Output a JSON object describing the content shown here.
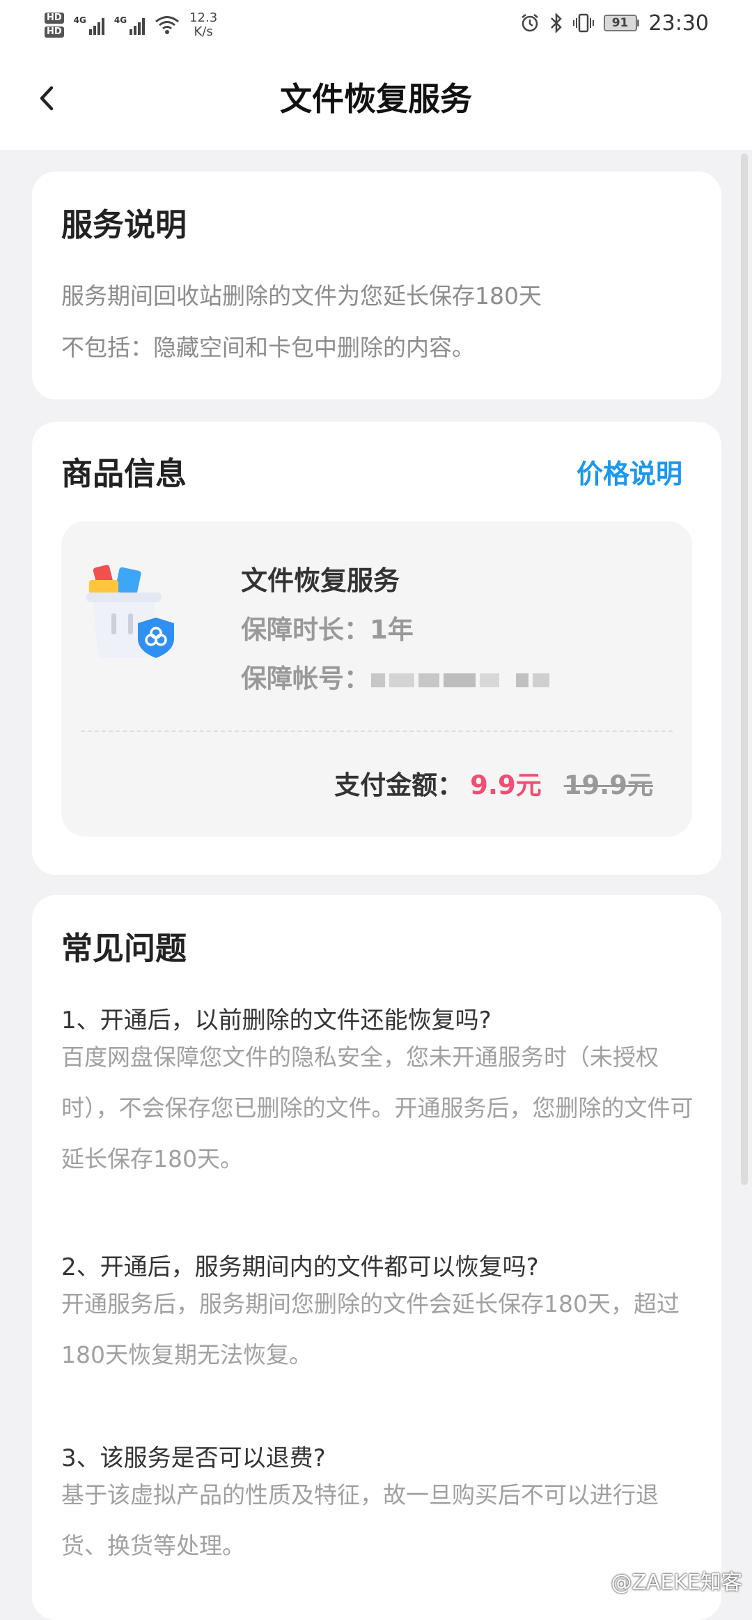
{
  "status_bar": {
    "hd1": "HD",
    "hd2": "HD",
    "net1": "4G",
    "net2": "4G",
    "speed_value": "12.3",
    "speed_unit": "K/s",
    "battery": "91",
    "time": "23:30"
  },
  "header": {
    "title": "文件恢复服务",
    "back_icon": "chevron-left-icon"
  },
  "service_card": {
    "title": "服务说明",
    "line1": "服务期间回收站删除的文件为您延长保存180天",
    "line2": "不包括：隐藏空间和卡包中删除的内容。"
  },
  "product_card": {
    "title": "商品信息",
    "price_link": "价格说明",
    "product_name": "文件恢复服务",
    "duration": "保障时长：1年",
    "account_label": "保障帐号：",
    "pay_label": "支付金额：",
    "price_now": "9.9元",
    "price_original": "19.9元",
    "accent_color": "#1b97f0",
    "price_color": "#ef4f71"
  },
  "faq_card": {
    "title": "常见问题",
    "items": [
      {
        "q": "1、开通后，以前删除的文件还能恢复吗?",
        "a": "百度网盘保障您文件的隐私安全，您未开通服务时（未授权时），不会保存您已删除的文件。开通服务后，您删除的文件可延长保存180天。"
      },
      {
        "q": "2、开通后，服务期间内的文件都可以恢复吗?",
        "a": "开通服务后，服务期间您删除的文件会延长保存180天，超过180天恢复期无法恢复。"
      },
      {
        "q": "3、该服务是否可以退费?",
        "a": "基于该虚拟产品的性质及特征，故一旦购买后不可以进行退货、换货等处理。"
      }
    ]
  },
  "watermark": "@ZAEKE知客"
}
